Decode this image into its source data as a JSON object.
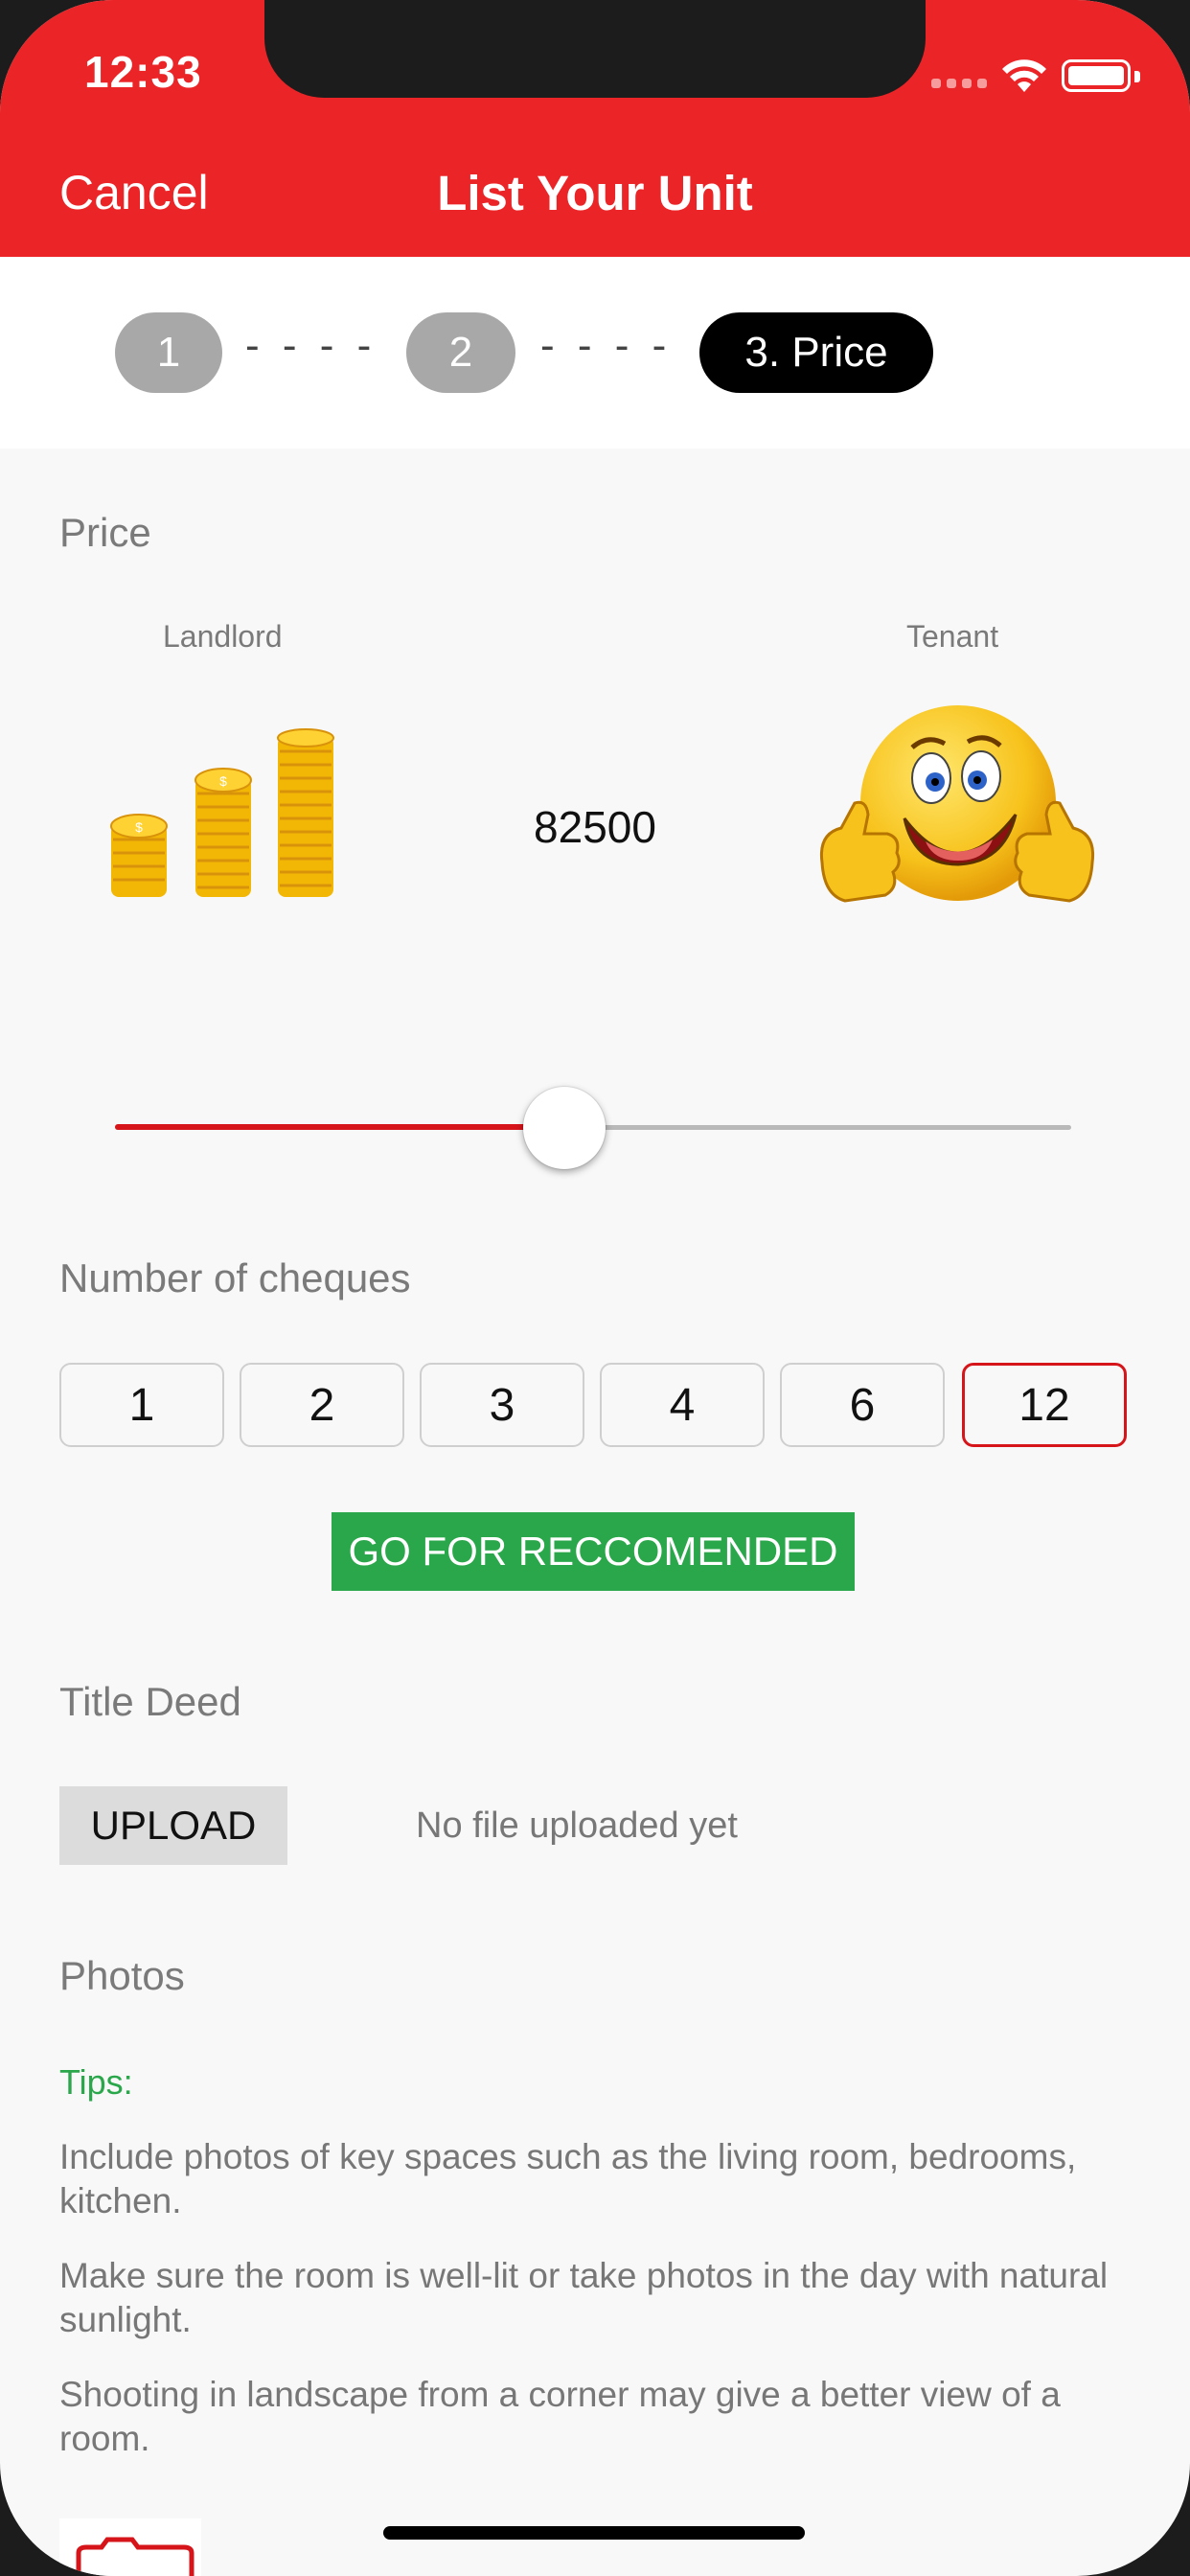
{
  "status_bar": {
    "time": "12:33",
    "icons": [
      "signal-icon",
      "wifi-icon",
      "battery-icon"
    ]
  },
  "nav": {
    "cancel_label": "Cancel",
    "title": "List Your Unit"
  },
  "steps": {
    "step1": "1",
    "step2": "2",
    "step3": "3. Price",
    "separator": "- - - -",
    "active_step": 3
  },
  "price": {
    "section_title": "Price",
    "landlord_label": "Landlord",
    "tenant_label": "Tenant",
    "value": "82500",
    "slider_fraction": 0.47
  },
  "cheques": {
    "section_title": "Number of cheques",
    "options": [
      "1",
      "2",
      "3",
      "4",
      "6",
      "12"
    ],
    "selected": "12"
  },
  "recommend_button_label": "GO FOR RECCOMENDED",
  "title_deed": {
    "section_title": "Title Deed",
    "upload_label": "UPLOAD",
    "status": "No file uploaded yet"
  },
  "photos": {
    "section_title": "Photos",
    "tips_label": "Tips:",
    "tips": [
      " Include photos of key spaces such as the living room, bedrooms, kitchen.",
      " Make sure the room is well-lit or take photos in the day with natural sunlight.",
      " Shooting in landscape from a corner may give a better view of a room."
    ]
  },
  "colors": {
    "accent_red": "#ea2427",
    "slider_red": "#d6151b",
    "recommend_green": "#2aa74a",
    "inactive_step": "#a8a8a8"
  }
}
